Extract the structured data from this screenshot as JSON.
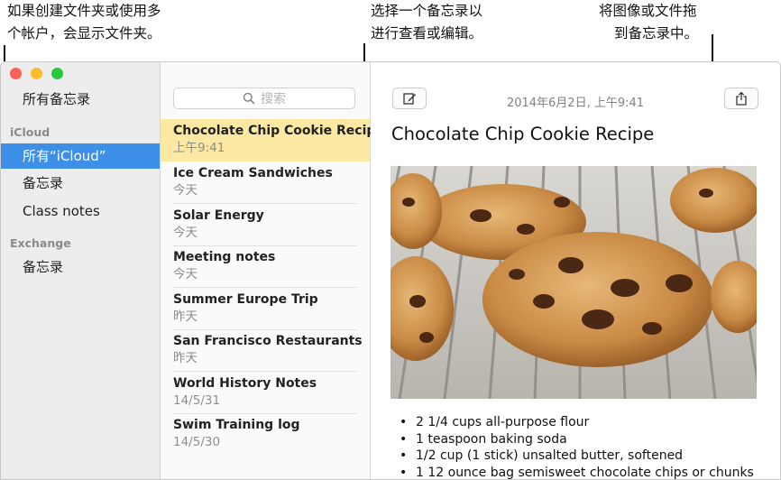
{
  "callouts": {
    "folders": [
      "如果创建文件夹或使用多",
      "个帐户，会显示文件夹。"
    ],
    "list": [
      "选择一个备忘录以",
      "进行查看或编辑。"
    ],
    "drag": [
      "将图像或文件拖",
      "到备忘录中。"
    ]
  },
  "sidebar": {
    "all_notes": "所有备忘录",
    "sections": [
      {
        "label": "iCloud",
        "items": [
          "所有“iCloud”",
          "备忘录",
          "Class notes"
        ]
      },
      {
        "label": "Exchange",
        "items": [
          "备忘录"
        ]
      }
    ]
  },
  "search": {
    "placeholder": "搜索"
  },
  "notes": [
    {
      "title": "Chocolate Chip Cookie Recipe",
      "date": "上午9:41"
    },
    {
      "title": "Ice Cream Sandwiches",
      "date": "今天"
    },
    {
      "title": "Solar Energy",
      "date": "今天"
    },
    {
      "title": "Meeting notes",
      "date": "今天"
    },
    {
      "title": "Summer Europe Trip",
      "date": "昨天"
    },
    {
      "title": "San Francisco Restaurants",
      "date": "昨天"
    },
    {
      "title": "World History Notes",
      "date": "14/5/31"
    },
    {
      "title": "Swim Training log",
      "date": "14/5/30"
    }
  ],
  "editor": {
    "datetime": "2014年6月2日, 上午9:41",
    "title": "Chocolate Chip Cookie Recipe",
    "ingredients": [
      "2 1/4 cups all-purpose flour",
      "1 teaspoon baking soda",
      "1/2 cup (1 stick) unsalted butter, softened",
      "1 12 ounce bag semisweet chocolate chips or chunks"
    ]
  },
  "icons": {
    "compose": "compose-icon",
    "share": "share-icon",
    "search": "search-icon"
  },
  "colors": {
    "sidebar_selection": "#3d8fe8",
    "note_selection": "#fbe8a2",
    "close": "#fc5f57",
    "minimize": "#fdbc2e",
    "zoom": "#28c840"
  }
}
